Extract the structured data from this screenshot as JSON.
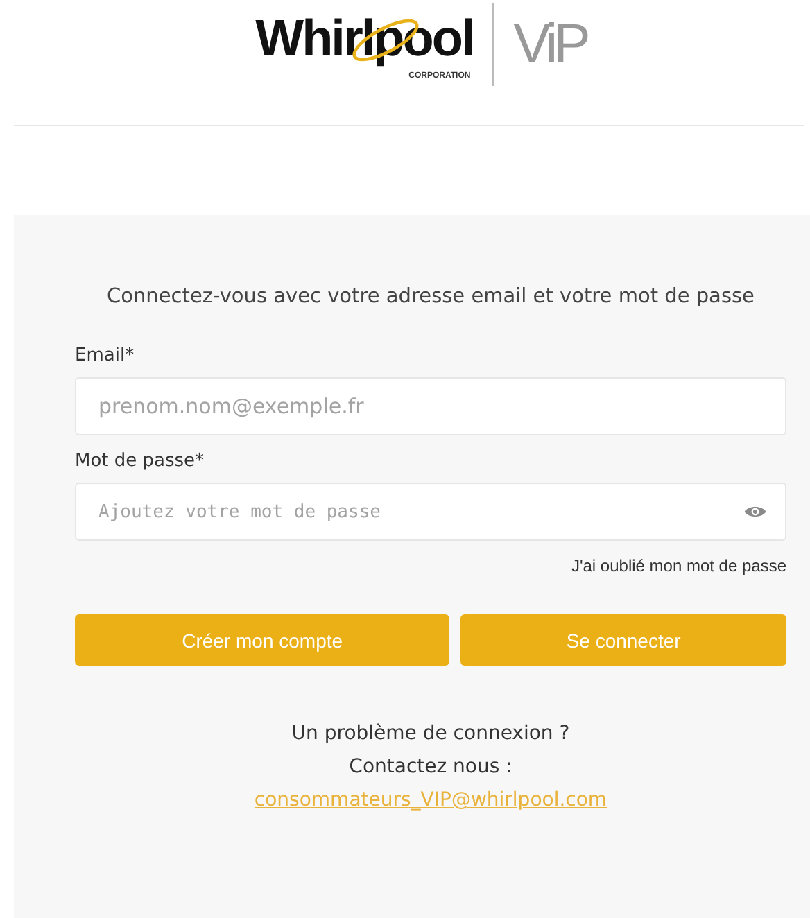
{
  "logo": {
    "brand": "Whirlpool",
    "subtitle": "CORPORATION",
    "program": "ViP"
  },
  "form": {
    "heading": "Connectez-vous avec votre adresse email et votre mot de passe",
    "fields": [
      {
        "kind": "email",
        "label": "Email*",
        "placeholder": "prenom.nom@exemple.fr"
      },
      {
        "kind": "password",
        "label": "Mot de passe*",
        "placeholder": "Ajoutez votre mot de passe"
      }
    ],
    "forgot_link": "J'ai oublié mon mot de passe",
    "buttons": [
      "Créer mon compte",
      "Se connecter"
    ],
    "help": {
      "question": "Un problème de connexion ?",
      "contact": "Contactez nous :",
      "email": "consommateurs_VIP@whirlpool.com"
    }
  }
}
